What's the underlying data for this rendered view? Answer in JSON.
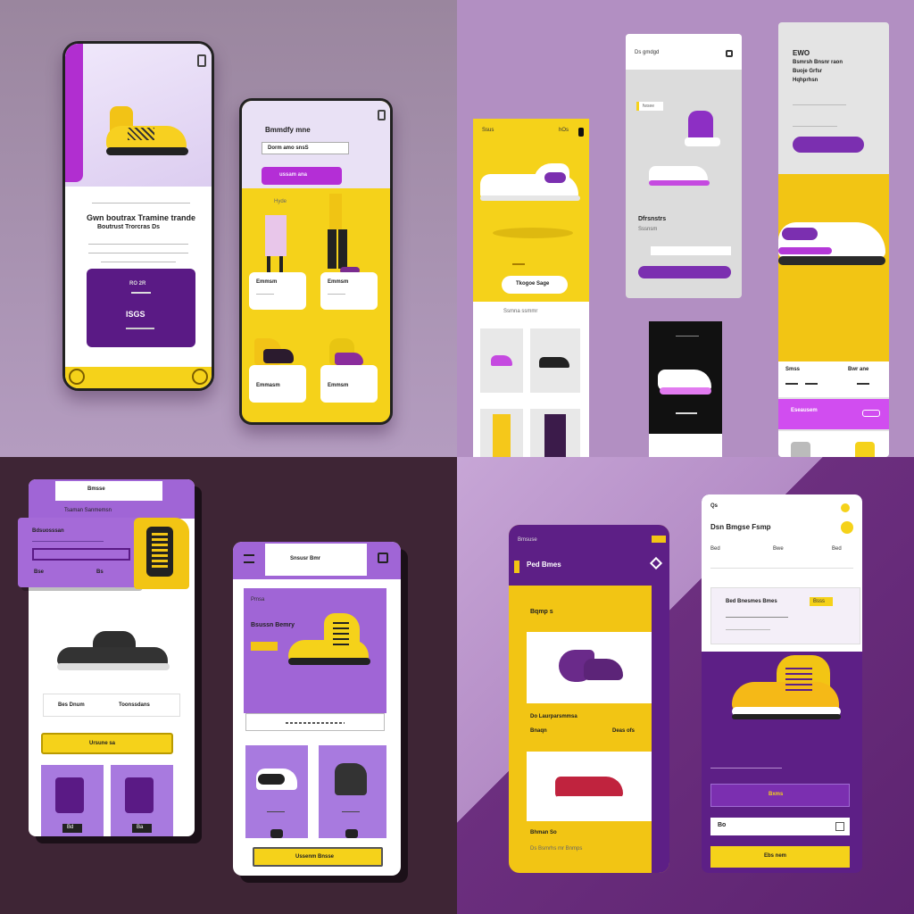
{
  "palette": {
    "purple": "#7b2fb0",
    "deep_purple": "#5a1a85",
    "yellow": "#f5d21a",
    "magenta": "#c54ae0",
    "lavender": "#a67ad9"
  },
  "q1": {
    "phone_a": {
      "headline": "Gwn boutrax Tramine trande",
      "subline": "Boutrust Trorcras Ds",
      "card_title": "RO 2R",
      "price": "ISGS"
    },
    "phone_b": {
      "title": "Bmmdfy mne",
      "search_value": "Dorm amo snsS",
      "button": "ussam ana",
      "tab": "Hyde",
      "items": [
        "Emmsm",
        "Emmsm",
        "Emmasm",
        "Emmsm"
      ]
    }
  },
  "q2": {
    "col_a": {
      "tag": "Ssus",
      "hero_label": "hOs",
      "cta": "Tkogoe Sage",
      "section": "Ssmna ssmmr"
    },
    "col_b": {
      "tab": "Ds gmdgd",
      "chip": "fwsee",
      "title": "Dfrsnstrs",
      "sub": "Sssnsm",
      "button": ""
    },
    "col_c": {
      "title": "EWO",
      "desc_1": "Bsmrsh Bnsnr raon",
      "desc_2": "Buoje Grfsr",
      "desc_3": "Hqhprhsn",
      "label_a": "Smss",
      "label_b": "Bwr ane",
      "promo": "Eseausem"
    }
  },
  "q3": {
    "phone_a": {
      "header": "Bmsse",
      "sub": "Tsaman Sanmemsn",
      "form_title": "Bdsuosssan",
      "price_a": "Bse",
      "price_b": "Bs",
      "field_a": "Bes Dnum",
      "field_b": "Toonssdans",
      "cta": "Ursune sa",
      "badges": [
        "Bd",
        "Ba"
      ]
    },
    "phone_b": {
      "header": "Snsusr Bmr",
      "title": "Pmsa",
      "hero": "Bsussn Bemry",
      "chip": "",
      "cta": "Ussenm Bnsse"
    }
  },
  "q4": {
    "phone_a": {
      "tag": "Bmsuse",
      "title": "Ped Bmes",
      "section": "Bqmp s",
      "item_a_name": "Do Laurparsmmsa",
      "item_a_tag": "Bnaqn",
      "item_a_price": "Deas ofs",
      "item_b_name": "Bhman So",
      "caption": "Ds Bsmrhs mr Bnmps"
    },
    "phone_b": {
      "meta": "Qs",
      "title": "Dsn Bmgse Fsmp",
      "cols": [
        "Bed",
        "Bwe",
        "Bed"
      ],
      "card_title": "Bed Bnesmes Bmes",
      "chip": "Bsss",
      "button": "Bxms",
      "input": "Bo",
      "cta": "Ebs nem"
    }
  }
}
